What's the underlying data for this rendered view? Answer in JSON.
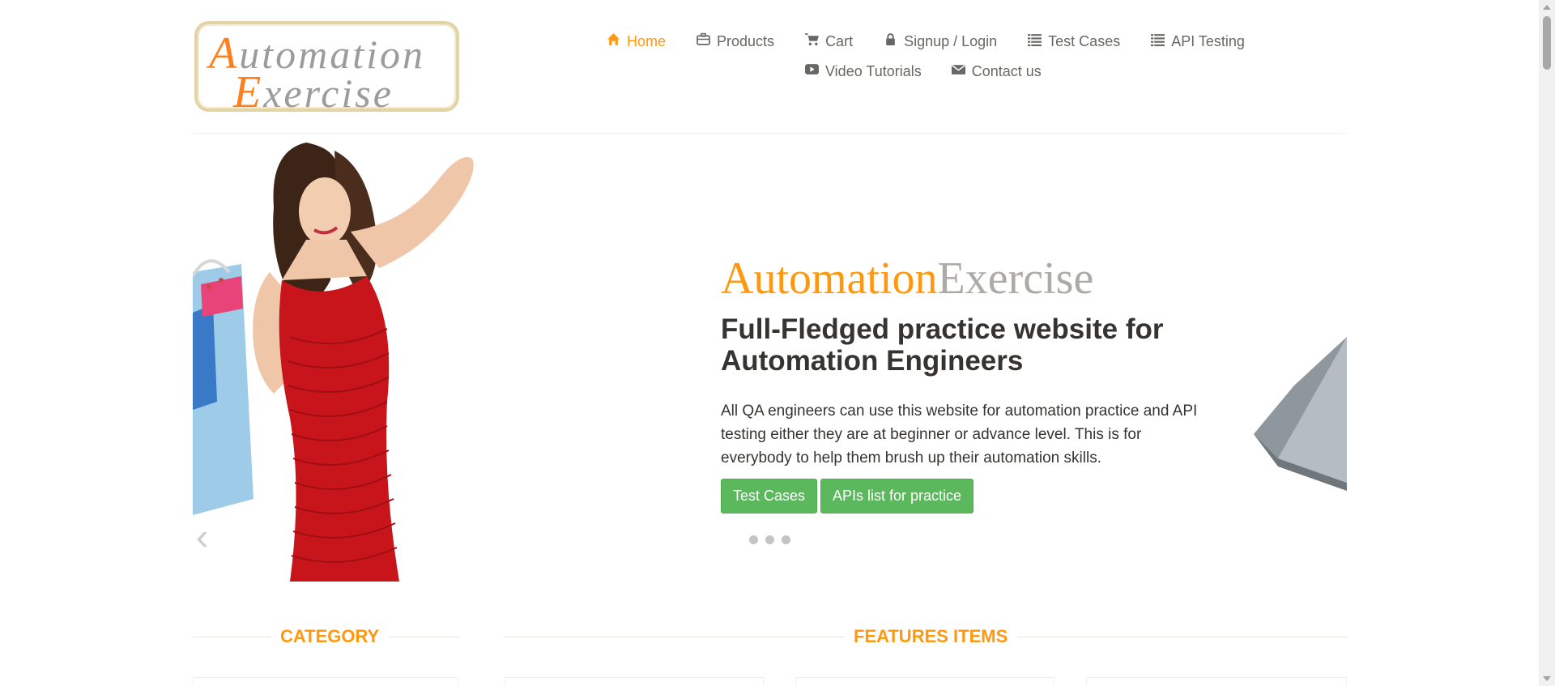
{
  "logo": {
    "line1_cap": "A",
    "line1_rest": "utomation",
    "line2_cap": "E",
    "line2_rest": "xercise"
  },
  "nav": {
    "row1": [
      {
        "icon": "home-icon",
        "label": "Home",
        "active": true
      },
      {
        "icon": "briefcase-icon",
        "label": "Products"
      },
      {
        "icon": "cart-icon",
        "label": "Cart"
      },
      {
        "icon": "lock-icon",
        "label": "Signup / Login"
      },
      {
        "icon": "list-icon",
        "label": "Test Cases"
      },
      {
        "icon": "list-icon",
        "label": "API Testing"
      }
    ],
    "row2": [
      {
        "icon": "youtube-play-icon",
        "label": "Video Tutorials"
      },
      {
        "icon": "envelope-icon",
        "label": "Contact us"
      }
    ]
  },
  "slider": {
    "brand_part1": "Automation",
    "brand_part2": "Exercise",
    "headline": "Full-Fledged practice website for Automation Engineers",
    "description": "All QA engineers can use this website for automation practice and API testing either they are at beginner or advance level. This is for everybody to help them brush up their automation skills.",
    "buttons": {
      "test_cases": "Test Cases",
      "apis_list": "APIs list for practice"
    },
    "prev_arrow": "‹",
    "dot_count": 3
  },
  "sections": {
    "category": "CATEGORY",
    "features": "FEATURES ITEMS"
  },
  "colors": {
    "accent": "#fe980f",
    "button_green": "#5cb85c",
    "text_dark": "#363432",
    "text_gray": "#696763"
  }
}
